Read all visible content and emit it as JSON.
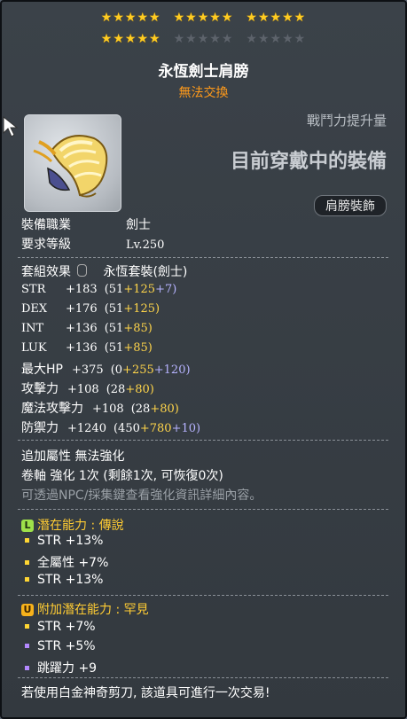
{
  "star_symbol": "★",
  "stars": {
    "row1": [
      5,
      5,
      5
    ],
    "row2": [
      5,
      0,
      0
    ],
    "filled_total": 20,
    "colors": {
      "on": "#ffcc22",
      "off": "#5d636b"
    }
  },
  "item": {
    "name": "永恆劍士肩膀",
    "trade_status": "無法交換",
    "power_hint": "戰鬥力提升量",
    "equip_hint": "目前穿戴中的裝備",
    "slot": "肩膀裝飾",
    "icon": "shoulder-armor-icon"
  },
  "requirements": {
    "job_label": "裝備職業",
    "job_value": "劍士",
    "level_label": "要求等級",
    "level_value": "Lv.250"
  },
  "set_effect": {
    "label": "套組效果",
    "value": "永恆套裝(劍士)"
  },
  "stats": [
    {
      "name": "STR",
      "total": "+183",
      "base": "(51",
      "bonus": "+125",
      "enh": "+7)"
    },
    {
      "name": "DEX",
      "total": "+176",
      "base": "(51",
      "bonus": "+125)",
      "enh": ""
    },
    {
      "name": "INT",
      "total": "+136",
      "base": "(51",
      "bonus": "+85)",
      "enh": ""
    },
    {
      "name": "LUK",
      "total": "+136",
      "base": "(51",
      "bonus": "+85)",
      "enh": ""
    },
    {
      "name": "最大HP",
      "total": "+375",
      "base": "(0",
      "bonus": "+255",
      "enh": "+120)"
    },
    {
      "name": "攻擊力",
      "total": "+108",
      "base": "(28",
      "bonus": "+80)",
      "enh": ""
    },
    {
      "name": "魔法攻擊力",
      "total": "+108",
      "base": "(28",
      "bonus": "+80)",
      "enh": ""
    },
    {
      "name": "防禦力",
      "total": "+1240",
      "base": "(450",
      "bonus": "+780",
      "enh": "+10)"
    }
  ],
  "extra": {
    "attribute": "追加屬性 無法強化",
    "scroll": "卷軸 強化 1次 (剩餘1次, 可恢復0次)",
    "npc_hint": "可透過NPC/採集鍵查看強化資訊詳細內容。"
  },
  "potential": {
    "badge": "L",
    "title": "潛在能力 : 傳說",
    "lines": [
      "STR +13%",
      "全屬性 +7%",
      "STR +13%"
    ],
    "bullet_color": "#ffd633"
  },
  "additional_potential": {
    "badge": "U",
    "title": "附加潛在能力 : 罕見",
    "lines": [
      "STR +7%",
      "STR +5%",
      "跳躍力 +9"
    ],
    "bullet_colors": [
      "#ffd633",
      "#b388ff",
      "#b388ff"
    ]
  },
  "footer": "若使用白金神奇剪刀, 該道具可進行一次交易!"
}
